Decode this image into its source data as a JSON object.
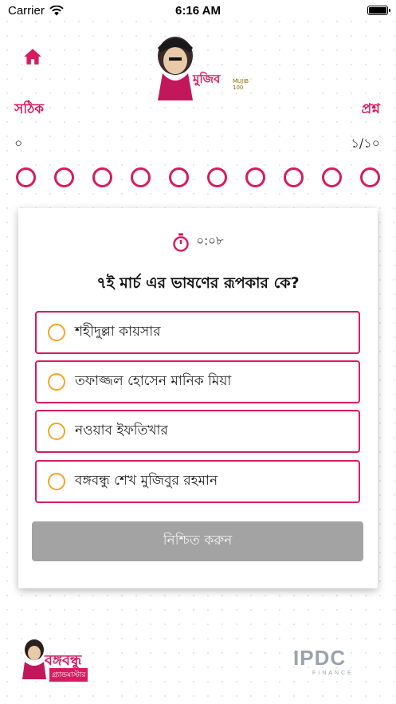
{
  "status_bar": {
    "carrier": "Carrier",
    "time": "6:16 AM"
  },
  "header": {
    "logo_text": "মুজিব",
    "logo_sub_text": "শতবর্ষ",
    "logo_number": "MUJIB 100"
  },
  "score": {
    "correct_label": "সঠিক",
    "correct_value": "০",
    "question_label": "প্রশ্ন",
    "question_value": "১/১০"
  },
  "progress": {
    "total": 10,
    "answered": 0
  },
  "quiz": {
    "timer": "০:০৮",
    "question": "৭ই মার্চ এর ভাষণের রূপকার কে?",
    "options": [
      {
        "label": "শহীদুল্লা কায়সার"
      },
      {
        "label": "তফাজ্জল হোসেন মানিক মিয়া"
      },
      {
        "label": "নওয়াব ইফতিখার"
      },
      {
        "label": "বঙ্গবন্ধু শেখ মুজিবুর রহমান"
      }
    ],
    "confirm_label": "নিশ্চিত করুন"
  },
  "sponsors": {
    "left_brand": "বঙ্গবন্ধু",
    "left_sub": "গ্র্যান্ডমাস্টার",
    "right_brand": "IPDC",
    "right_sub": "FINANCE"
  },
  "colors": {
    "accent": "#d81b60",
    "radio": "#f5a623",
    "button_disabled": "#a3a3a3"
  }
}
